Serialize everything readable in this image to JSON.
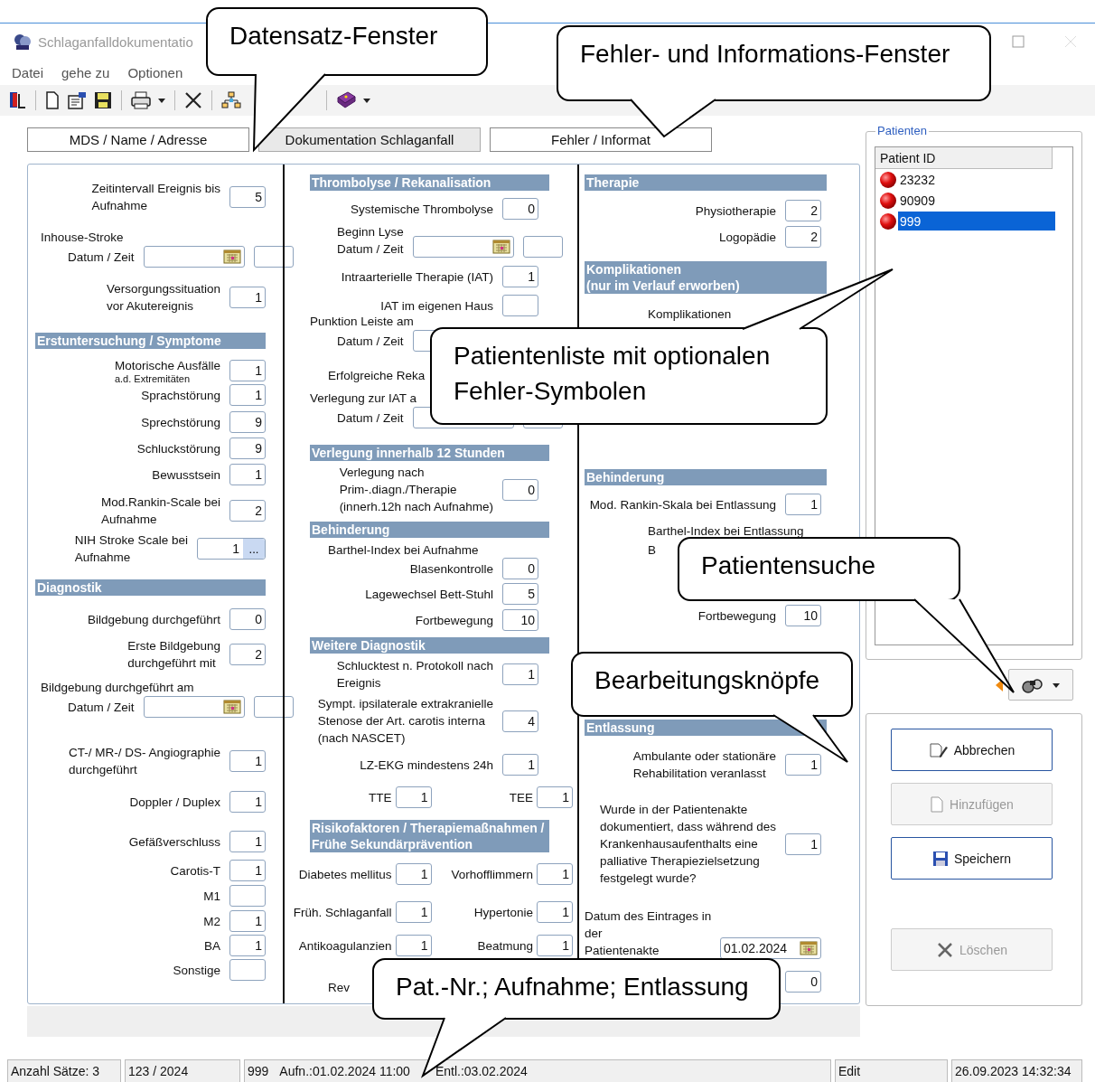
{
  "window": {
    "title": "Schlaganfalldokumentatio"
  },
  "menu": [
    "Datei",
    "gehe zu",
    "Optionen"
  ],
  "tabs": [
    {
      "label": "MDS / Name / Adresse",
      "selected": false
    },
    {
      "label": "Dokumentation Schlaganfall",
      "selected": true
    },
    {
      "label": "Fehler / Informat",
      "selected": false
    }
  ],
  "columns": [
    {
      "items": [
        {
          "kind": "field",
          "label": "Zeitintervall Ereignis bis\nAufnahme",
          "value": "5"
        },
        {
          "kind": "datetime",
          "caption": "Inhouse-Stroke",
          "label": "Datum / Zeit"
        },
        {
          "kind": "field",
          "label": "Versorgungssituation\nvor Akutereignis",
          "value": "1"
        },
        {
          "kind": "header",
          "text": "Erstuntersuchung / Symptome"
        },
        {
          "kind": "field",
          "label": "Motorische Ausfälle",
          "sublabel": "a.d. Extremitäten",
          "value": "1"
        },
        {
          "kind": "field",
          "label": "Sprachstörung",
          "value": "1"
        },
        {
          "kind": "field",
          "label": "Sprechstörung",
          "value": "9"
        },
        {
          "kind": "field",
          "label": "Schluckstörung",
          "value": "9"
        },
        {
          "kind": "field",
          "label": "Bewusstsein",
          "value": "1"
        },
        {
          "kind": "field",
          "label": "Mod.Rankin-Scale bei\nAufnahme",
          "value": "2"
        },
        {
          "kind": "lookup",
          "label": "NIH Stroke Scale bei\nAufnahme",
          "value": "1",
          "button": "..."
        },
        {
          "kind": "header",
          "text": "Diagnostik"
        },
        {
          "kind": "field",
          "label": "Bildgebung durchgeführt",
          "value": "0"
        },
        {
          "kind": "field",
          "label": "Erste Bildgebung\ndurchgeführt mit",
          "value": "2"
        },
        {
          "kind": "datetime",
          "caption": "Bildgebung durchgeführt am",
          "label": "Datum / Zeit"
        },
        {
          "kind": "field",
          "label": "CT-/ MR-/ DS- Angiographie\ndurchgeführt",
          "value": "1"
        },
        {
          "kind": "field",
          "label": "Doppler / Duplex",
          "value": "1"
        },
        {
          "kind": "field",
          "label": "Gefäßverschluss",
          "value": "1"
        },
        {
          "kind": "field",
          "label": "Carotis-T",
          "value": "1"
        },
        {
          "kind": "field",
          "label": "M1"
        },
        {
          "kind": "field",
          "label": "M2",
          "value": "1"
        },
        {
          "kind": "field",
          "label": "BA",
          "value": "1"
        },
        {
          "kind": "field",
          "label": "Sonstige"
        }
      ]
    },
    {
      "items": [
        {
          "kind": "header",
          "text": "Thrombolyse / Rekanalisation"
        },
        {
          "kind": "field",
          "label": "Systemische Thrombolyse",
          "value": "0"
        },
        {
          "kind": "datetime",
          "label": "Beginn Lyse\nDatum / Zeit"
        },
        {
          "kind": "field",
          "label": "Intraarterielle Therapie (IAT)",
          "value": "1"
        },
        {
          "kind": "field",
          "label": "IAT im eigenen Haus"
        },
        {
          "kind": "datetime",
          "caption": "Punktion Leiste am",
          "label": "Datum / Zeit"
        },
        {
          "kind": "text",
          "text": "Erfolgreiche Reka"
        },
        {
          "kind": "datetime",
          "caption": "Verlegung zur IAT a",
          "label": "Datum / Zeit"
        },
        {
          "kind": "header",
          "text": "Verlegung innerhalb 12 Stunden"
        },
        {
          "kind": "field",
          "label": "Verlegung nach\nPrim-.diagn./Therapie\n(innerh.12h nach Aufnahme)",
          "value": "0"
        },
        {
          "kind": "header",
          "text": "Behinderung"
        },
        {
          "kind": "text",
          "text": "Barthel-Index bei Aufnahme"
        },
        {
          "kind": "field",
          "label": "Blasenkontrolle",
          "value": "0"
        },
        {
          "kind": "field",
          "label": "Lagewechsel Bett-Stuhl",
          "value": "5"
        },
        {
          "kind": "field",
          "label": "Fortbewegung",
          "value": "10"
        },
        {
          "kind": "header",
          "text": "Weitere Diagnostik"
        },
        {
          "kind": "field",
          "label": "Schlucktest n. Protokoll nach\nEreignis",
          "value": "1"
        },
        {
          "kind": "field",
          "label": "Sympt. ipsilaterale extrakranielle\nStenose der Art. carotis interna\n(nach NASCET)",
          "value": "4"
        },
        {
          "kind": "field",
          "label": "LZ-EKG mindestens 24h",
          "value": "1"
        },
        {
          "kind": "pair",
          "fields": [
            {
              "label": "TTE",
              "value": "1"
            },
            {
              "label": "TEE",
              "value": "1"
            }
          ]
        },
        {
          "kind": "header",
          "text": "Risikofaktoren / Therapiemaßnahmen /\nFrühe Sekundärprävention"
        },
        {
          "kind": "pair",
          "fields": [
            {
              "label": "Diabetes mellitus",
              "value": "1"
            },
            {
              "label": "Vorhofflimmern",
              "value": "1"
            }
          ]
        },
        {
          "kind": "pair",
          "fields": [
            {
              "label": "Früh. Schlaganfall",
              "value": "1"
            },
            {
              "label": "Hypertonie",
              "value": "1"
            }
          ]
        },
        {
          "kind": "pair",
          "fields": [
            {
              "label": "Antikoagulanzien",
              "value": "1"
            },
            {
              "label": "Beatmung",
              "value": "1"
            }
          ]
        },
        {
          "kind": "text",
          "text": "Rev"
        }
      ]
    },
    {
      "items": [
        {
          "kind": "header",
          "text": "Therapie"
        },
        {
          "kind": "field",
          "label": "Physiotherapie",
          "value": "2"
        },
        {
          "kind": "field",
          "label": "Logopädie",
          "value": "2"
        },
        {
          "kind": "header",
          "text": "Komplikationen\n(nur im Verlauf erworben)"
        },
        {
          "kind": "text",
          "text": "Komplikationen"
        },
        {
          "kind": "header",
          "text": "Behinderung"
        },
        {
          "kind": "field",
          "label": "Mod. Rankin-Skala bei Entlassung",
          "value": "1"
        },
        {
          "kind": "text",
          "text": "Barthel-Index bei Entlassung"
        },
        {
          "kind": "text",
          "text": "B"
        },
        {
          "kind": "field",
          "label": "Fortbewegung",
          "value": "10"
        },
        {
          "kind": "header",
          "text": "Entlassung"
        },
        {
          "kind": "field",
          "label": "Ambulante oder stationäre\nRehabilitation veranlasst",
          "value": "1"
        },
        {
          "kind": "field",
          "label": "Wurde in der Patientenakte\ndokumentiert, dass während des\nKrankenhausaufenthalts eine\npalliative Therapiezielsetzung\nfestgelegt wurde?",
          "value": "1"
        },
        {
          "kind": "date",
          "label": "Datum des Eintrages in der\nPatientenakte",
          "value": "01.02.2024"
        },
        {
          "kind": "field",
          "value": "0"
        }
      ]
    }
  ],
  "patients": {
    "title": "Patienten",
    "column": "Patient ID",
    "rows": [
      {
        "id": "23232",
        "error": true,
        "selected": false
      },
      {
        "id": "90909",
        "error": true,
        "selected": false
      },
      {
        "id": "999",
        "error": true,
        "selected": true
      }
    ]
  },
  "actions": [
    {
      "label": "Abbrechen",
      "disabled": false
    },
    {
      "label": "Hinzufügen",
      "disabled": true
    },
    {
      "label": "Speichern",
      "disabled": false
    },
    {
      "label": "Löschen",
      "disabled": true
    }
  ],
  "status_bar": [
    {
      "texts": [
        "Anzahl Sätze: 3"
      ]
    },
    {
      "texts": [
        "123 / 2024"
      ]
    },
    {
      "texts": [
        "999",
        "Aufn.:01.02.2024 11:00",
        "Entl.:03.02.2024"
      ]
    },
    {
      "texts": [
        "Edit"
      ]
    },
    {
      "texts": [
        "26.09.2023 14:32:34"
      ]
    }
  ],
  "callouts": [
    {
      "text": "Datensatz-Fenster"
    },
    {
      "text": "Fehler- und Informations-Fenster"
    },
    {
      "text": "Patientenliste mit optionalen\nFehler-Symbolen"
    },
    {
      "text": "Patientensuche"
    },
    {
      "text": "Bearbeitungsknöpfe"
    },
    {
      "text": "Pat.-Nr.; Aufnahme; Entlassung"
    }
  ]
}
